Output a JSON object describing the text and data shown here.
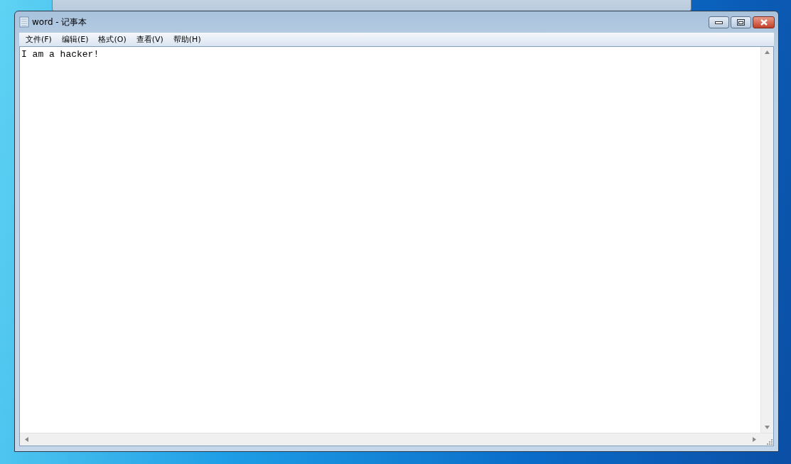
{
  "window": {
    "title": "word - 记事本"
  },
  "menu": [
    {
      "label": "文件(F)"
    },
    {
      "label": "编辑(E)"
    },
    {
      "label": "格式(O)"
    },
    {
      "label": "查看(V)"
    },
    {
      "label": "帮助(H)"
    }
  ],
  "document": {
    "text": "I am a hacker!"
  }
}
